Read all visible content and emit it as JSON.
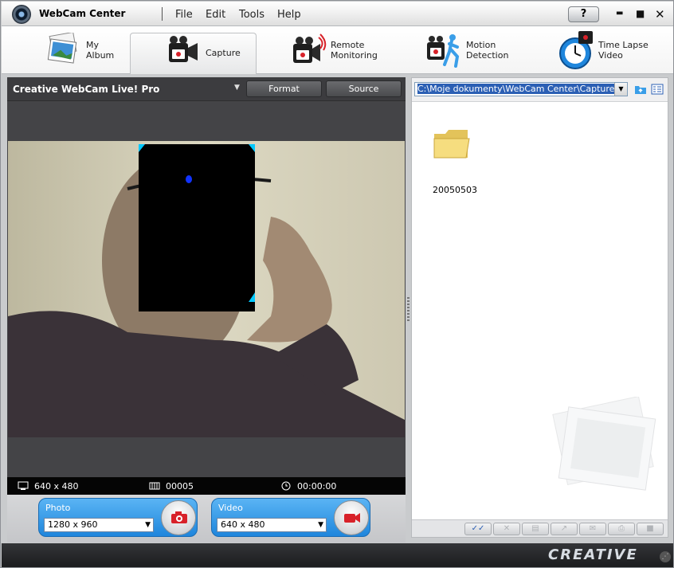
{
  "app": {
    "title": "WebCam Center"
  },
  "menu": [
    "File",
    "Edit",
    "Tools",
    "Help"
  ],
  "window_controls": {
    "help": "?",
    "minimize": "▬",
    "maximize": "■",
    "close": "✕"
  },
  "tabs": [
    {
      "label_line1": "My",
      "label_line2": "Album",
      "icon": "photo-album-icon"
    },
    {
      "label_line1": "Capture",
      "label_line2": "",
      "icon": "video-camera-icon",
      "active": true
    },
    {
      "label_line1": "Remote",
      "label_line2": "Monitoring",
      "icon": "remote-camera-icon"
    },
    {
      "label_line1": "Motion",
      "label_line2": "Detection",
      "icon": "motion-camera-icon"
    },
    {
      "label_line1": "Time Lapse",
      "label_line2": "Video",
      "icon": "stopwatch-icon"
    }
  ],
  "camera": {
    "name": "Creative WebCam Live! Pro",
    "dropdown_arrow": "▼",
    "format_label": "Format",
    "source_label": "Source"
  },
  "status": {
    "resolution": "640 x 480",
    "frames": "00005",
    "time": "00:00:00"
  },
  "photo": {
    "label": "Photo",
    "size": "1280 x 960"
  },
  "video": {
    "label": "Video",
    "size": "640 x 480"
  },
  "browser": {
    "path": "C:\\Moje dokumenty\\WebCam Center\\Capture",
    "items": [
      {
        "name": "20050503",
        "type": "folder"
      }
    ]
  },
  "footer": {
    "logo": "CREATIVE"
  },
  "colors": {
    "accent_blue": "#1f86dc",
    "dark_panel": "#444447",
    "record_red": "#d8222a"
  }
}
